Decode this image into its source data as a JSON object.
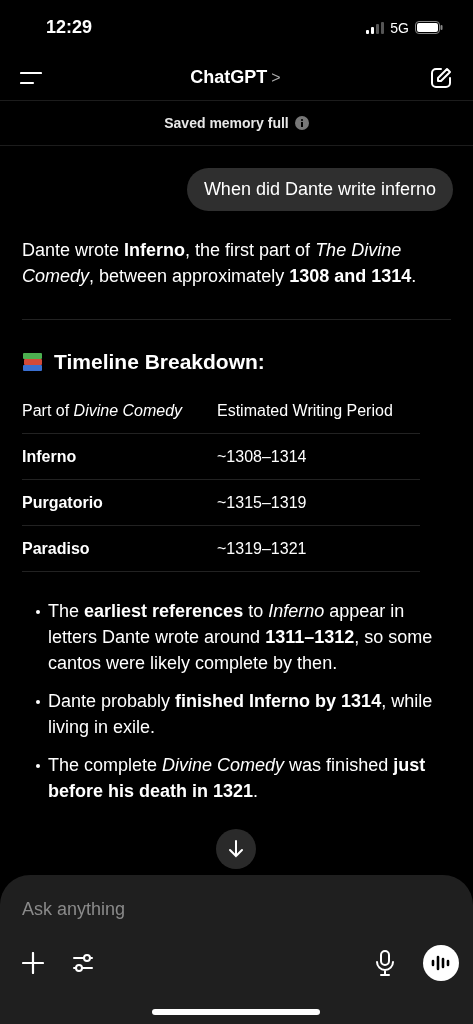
{
  "status_bar": {
    "time": "12:29",
    "network": "5G"
  },
  "header": {
    "title": "ChatGPT",
    "chevron": ">"
  },
  "banner": {
    "text": "Saved memory full"
  },
  "user_message": "When did Dante write inferno",
  "answer": {
    "intro": "Dante wrote **Inferno**, the first part of *The Divine Comedy*, between approximately **1308 and 1314**.",
    "heading": "Timeline Breakdown:",
    "table": {
      "columns": [
        "Part of *Divine Comedy*",
        "Estimated Writing Period"
      ],
      "rows": [
        {
          "part": "Inferno",
          "period": "~1308–1314"
        },
        {
          "part": "Purgatorio",
          "period": "~1315–1319"
        },
        {
          "part": "Paradiso",
          "period": "~1319–1321"
        }
      ]
    },
    "bullets": [
      "The **earliest references** to *Inferno* appear in letters Dante wrote around **1311–1312**, so some cantos were likely complete by then.",
      "Dante probably **finished Inferno by 1314**, while living in exile.",
      "The complete *Divine Comedy* was finished **just before his death in 1321**."
    ]
  },
  "composer": {
    "placeholder": "Ask anything"
  }
}
